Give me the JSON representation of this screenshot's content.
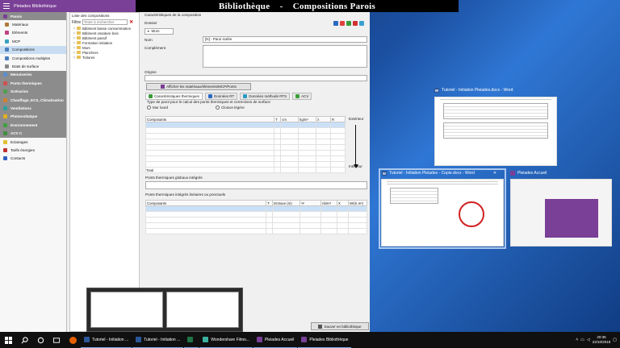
{
  "app": {
    "title": "Pleiades Bibliothèque",
    "banner": "Bibliothèque    -    Compositions Parois"
  },
  "sidebar": {
    "items": [
      {
        "label": "Parois",
        "kind": "section",
        "icon": "walls-icon",
        "color": "#7a3f96"
      },
      {
        "label": "Matériaux",
        "kind": "sub",
        "icon": "materials-icon",
        "color": "#b07a3a"
      },
      {
        "label": "Eléments",
        "kind": "sub",
        "icon": "elements-icon",
        "color": "#c04080"
      },
      {
        "label": "MCP",
        "kind": "sub",
        "icon": "mcp-icon",
        "color": "#3aa0c0"
      },
      {
        "label": "Compositions",
        "kind": "sub active",
        "icon": "compositions-icon",
        "color": "#4a7fc0"
      },
      {
        "label": "Compositions multiples",
        "kind": "sub",
        "icon": "multi-compositions-icon",
        "color": "#4a7fc0"
      },
      {
        "label": "Etats de surface",
        "kind": "sub",
        "icon": "surface-icon",
        "color": "#888"
      },
      {
        "label": "Menuiseries",
        "kind": "section",
        "icon": "window-icon",
        "color": "#5a8fd0"
      },
      {
        "label": "Ponts thermiques",
        "kind": "section",
        "icon": "thermal-bridge-icon",
        "color": "#d05050"
      },
      {
        "label": "Scénarios",
        "kind": "section",
        "icon": "scenario-icon",
        "color": "#50a050"
      },
      {
        "label": "Chauffage, ECS, Climatisation",
        "kind": "section",
        "icon": "heating-icon",
        "color": "#d08030"
      },
      {
        "label": "Ventilations",
        "kind": "section",
        "icon": "ventilation-icon",
        "color": "#30a0a0"
      },
      {
        "label": "Photovoltaïque",
        "kind": "section",
        "icon": "solar-icon",
        "color": "#e0b020"
      },
      {
        "label": "Environnement",
        "kind": "section",
        "icon": "environment-icon",
        "color": "#40a040"
      },
      {
        "label": "ACV C",
        "kind": "section",
        "icon": "acv-icon",
        "color": "#409040"
      },
      {
        "label": "Eclairages",
        "kind": "plain",
        "icon": "lighting-icon",
        "color": "#e0c030"
      },
      {
        "label": "Tarifs énergies",
        "kind": "plain",
        "icon": "tariff-icon",
        "color": "#c03030"
      },
      {
        "label": "Contacts",
        "kind": "plain",
        "icon": "contacts-icon",
        "color": "#3060c0"
      }
    ]
  },
  "tree": {
    "header": "Liste des compositions",
    "filter_label": "Filtre",
    "filter_placeholder": "Texte à rechercher",
    "items": [
      "Bâtiment basse consommation",
      "Bâtiment ossature bois",
      "Bâtiment passif",
      "Formation initiation",
      "Murs",
      "Planchers",
      "Toitures"
    ]
  },
  "main": {
    "section_title": "Caractéristiques de la composition",
    "folder_label": "Dossier",
    "folder_value": "Murs",
    "name_label": "Nom",
    "name_value": "[N] - Paroi isolée",
    "complement_label": "Complément",
    "origin_label": "Origine",
    "show_button": "Afficher les matériaux/éléments/MCP/Ponts",
    "tabs": [
      {
        "label": "Caractéristiques thermiques",
        "color": "#3a9a3a"
      },
      {
        "label": "Données RT",
        "color": "#2a6ac0"
      },
      {
        "label": "Données méthode RTS",
        "color": "#2a9ac0"
      },
      {
        "label": "ACV",
        "color": "#3aa03a"
      }
    ],
    "type_text": "Type de paroi pour le calcul des ponts thermiques et corrections de surface",
    "radio_heavy": "Mur lourd",
    "radio_light": "Cloison légère",
    "comp_columns": [
      "Composants",
      "T",
      "cm",
      "kg/m²",
      "λ",
      "R"
    ],
    "total_label": "Total",
    "exterior_label": "Extérieur",
    "interior_label": "Intérieur",
    "global_bridges_label": "Ponts thermiques globaux intégrés",
    "linear_bridges_label": "Ponts thermiques intégrés linéaires ou ponctuels",
    "bridge_columns": [
      "Composants",
      "T",
      "Entraxe (m)",
      "Ψ",
      "nb/m²",
      "X",
      "W/(K.m²)"
    ],
    "save_button": "Sauver en bibliothèque"
  },
  "desktop": {
    "word_window_title": "Tutoriel - Initiation Pleiades.docx - Word",
    "word_copy_title": "Tutoriel - Initiation Pleiades - Copie.docx - Word",
    "pleiades_home_title": "Pleiades Accueil"
  },
  "taskbar": {
    "apps": [
      {
        "label": "Tutoriel - Initiation ...",
        "color": "#2b579a",
        "icon": "word-icon"
      },
      {
        "label": "Tutoriel - Initiation ...",
        "color": "#2b579a",
        "icon": "word-icon"
      },
      {
        "label": "",
        "color": "#217346",
        "icon": "excel-icon"
      },
      {
        "label": "Wondershare Filmo...",
        "color": "#3ab0a0",
        "icon": "filmora-icon"
      },
      {
        "label": "Pleiades Accueil",
        "color": "#7a3f96",
        "icon": "pleiades-icon"
      },
      {
        "label": "Pleiades Bibliothèque",
        "color": "#7a3f96",
        "icon": "pleiades-icon"
      }
    ],
    "time": "20:36",
    "date": "22/10/2019"
  }
}
